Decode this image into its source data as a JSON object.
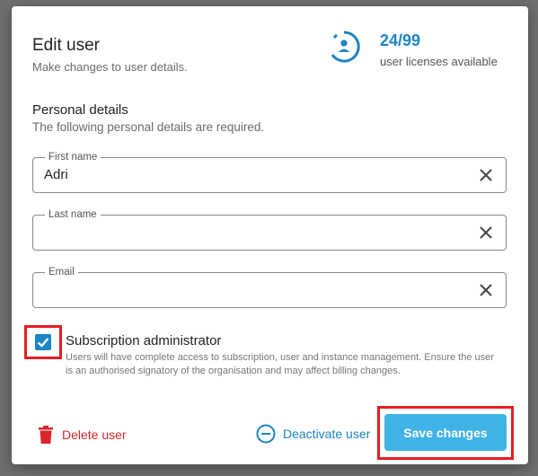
{
  "dialog": {
    "title": "Edit user",
    "subtitle": "Make changes to user details."
  },
  "licenses": {
    "count": "24/99",
    "label": "user licenses available",
    "icon": "user-circle-icon"
  },
  "personal": {
    "title": "Personal details",
    "subtitle": "The following personal details are required."
  },
  "fields": {
    "first_name": {
      "label": "First name",
      "value": "Adri"
    },
    "last_name": {
      "label": "Last name",
      "value": ""
    },
    "email": {
      "label": "Email",
      "value": ""
    }
  },
  "admin": {
    "checked": true,
    "label": "Subscription administrator",
    "description": "Users will have complete access to subscription, user and instance management. Ensure the user is an authorised signatory of the organisation and may affect billing changes."
  },
  "actions": {
    "delete_label": "Delete user",
    "deactivate_label": "Deactivate user",
    "save_label": "Save changes"
  },
  "colors": {
    "accent": "#1b86c4",
    "danger": "#d9262b",
    "save_bg": "#3fb3e6",
    "highlight": "#e31e24"
  }
}
